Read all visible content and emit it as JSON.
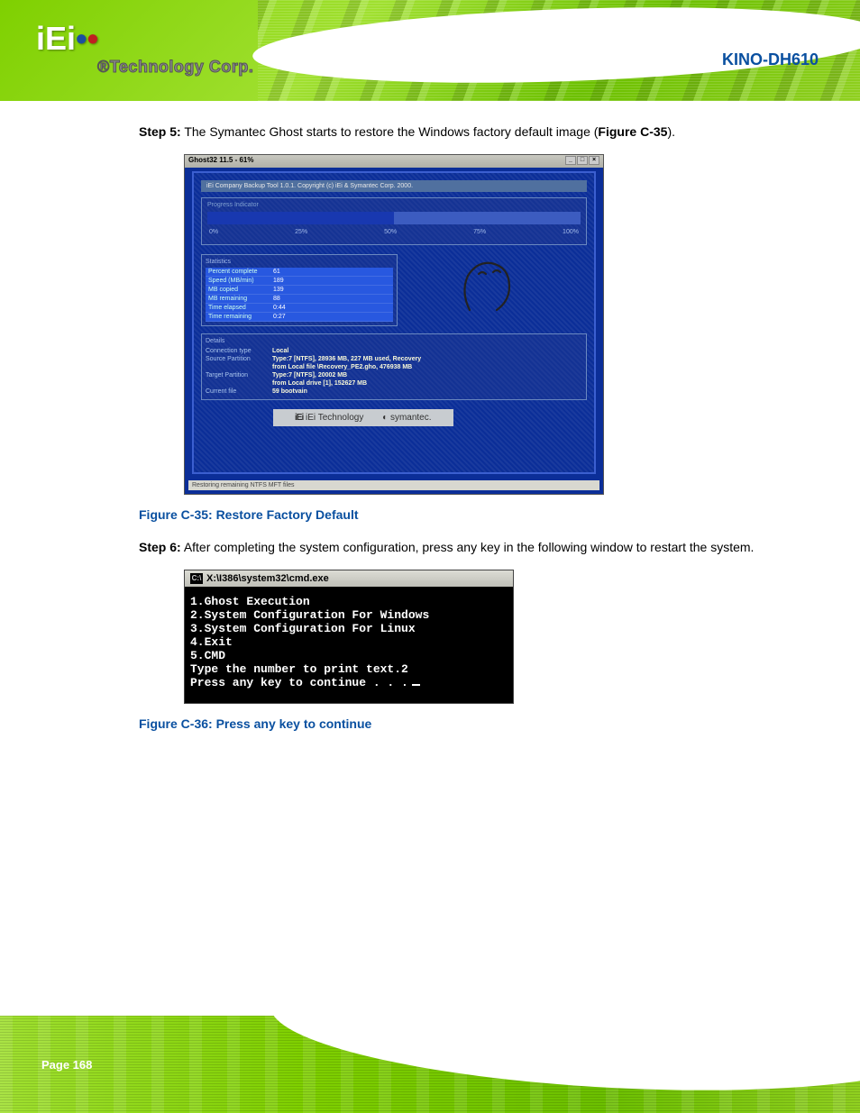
{
  "brand": {
    "logo_text": "iEi",
    "subtitle": "®Technology Corp."
  },
  "board_title": "KINO-DH610",
  "steps": {
    "step5": {
      "label": "Step 5:",
      "text": "The Symantec Ghost starts to restore the Windows factory default image (Figure C-35)."
    },
    "step6": {
      "label": "Step 6:",
      "text": "After completing the system configuration, press any key in the following window to restart the system."
    }
  },
  "captions": {
    "fig35": "Figure C-35: Restore Factory Default",
    "fig36": "Figure C-36: Press any key to continue"
  },
  "ghost": {
    "title": "Ghost32 11.5 - 61%",
    "header": "iEi Company Backup Tool 1.0.1.  Copyright (c) iEi & Symantec Corp. 2000.",
    "progress_label": "Progress Indicator",
    "ticks": {
      "t0": "0%",
      "t25": "25%",
      "t50": "50%",
      "t75": "75%",
      "t100": "100%"
    },
    "stats_title": "Statistics",
    "stats": {
      "percent_complete": {
        "k": "Percent complete",
        "v": "61"
      },
      "speed": {
        "k": "Speed (MB/min)",
        "v": "189"
      },
      "mb_copied": {
        "k": "MB copied",
        "v": "139"
      },
      "mb_remaining": {
        "k": "MB remaining",
        "v": "88"
      },
      "time_elapsed": {
        "k": "Time elapsed",
        "v": "0:44"
      },
      "time_remaining": {
        "k": "Time remaining",
        "v": "0:27"
      }
    },
    "details_title": "Details",
    "details": {
      "connection_type": {
        "k": "Connection type",
        "v": "Local"
      },
      "source_partition": {
        "k": "Source Partition",
        "v": "Type:7 [NTFS], 28936 MB, 227 MB used, Recovery"
      },
      "source_partition2": {
        "k": "",
        "v": "from Local file \\Recovery_PE2.gho, 476938 MB"
      },
      "target_partition": {
        "k": "Target Partition",
        "v": "Type:7 [NTFS], 20002 MB"
      },
      "target_partition2": {
        "k": "",
        "v": "from Local drive [1], 152627 MB"
      },
      "current_file": {
        "k": "Current file",
        "v": "59 bootvain"
      }
    },
    "logos": {
      "iei": "iEi Technology",
      "symantec": "symantec."
    },
    "statusbar": "Restoring remaining NTFS MFT files"
  },
  "cmd": {
    "title": "X:\\I386\\system32\\cmd.exe",
    "lines": {
      "l1": "1.Ghost Execution",
      "l2": "2.System Configuration For Windows",
      "l3": "3.System Configuration For Linux",
      "l4": "4.Exit",
      "l5": "5.CMD",
      "l6": "Type the number to print text.2",
      "l7": "Press any key to continue . . ."
    }
  },
  "page_number": "Page 168"
}
